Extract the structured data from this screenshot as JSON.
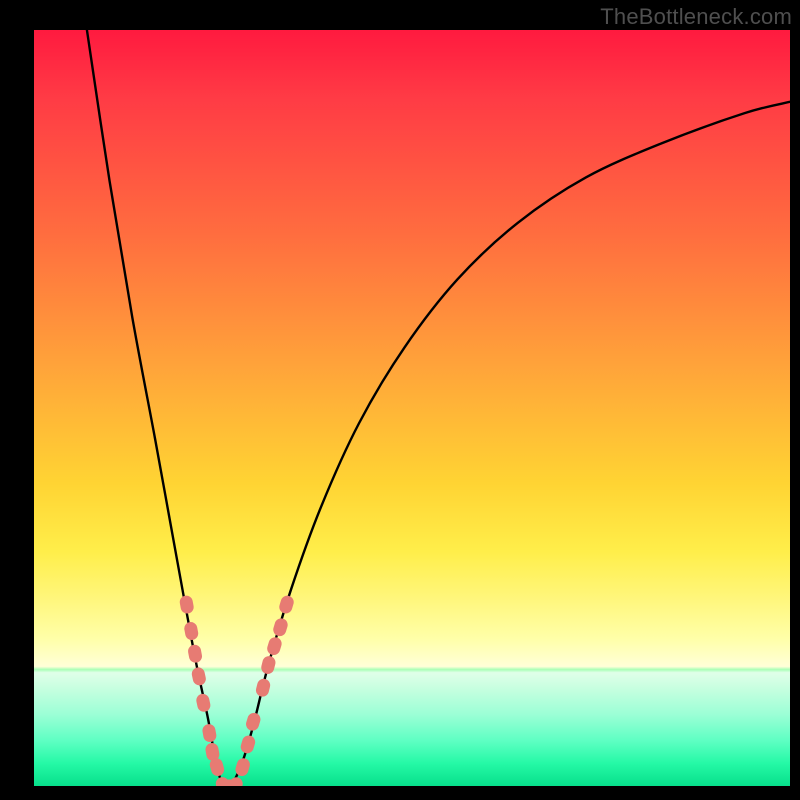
{
  "watermark": "TheBottleneck.com",
  "colors": {
    "background": "#000000",
    "curve_stroke": "#000000",
    "marker_fill": "#e77b73",
    "gradient_top": "#ff1a3f",
    "gradient_bottom": "#07e08b"
  },
  "chart_data": {
    "type": "line",
    "title": "",
    "xlabel": "",
    "ylabel": "",
    "xlim": [
      0,
      100
    ],
    "ylim": [
      0,
      100
    ],
    "grid": false,
    "note": "V-shaped bottleneck curve; y is bottleneck severity (0 = optimal pairing, 100 = extreme bottleneck). Gradient background encodes severity (green good → red bad). Values estimated from pixels.",
    "series": [
      {
        "name": "bottleneck-curve",
        "x": [
          7,
          10,
          13,
          16,
          18,
          20,
          21.5,
          23,
          24,
          25,
          26,
          27.5,
          29,
          31,
          34,
          38,
          43,
          49,
          56,
          64,
          73,
          83,
          94,
          100
        ],
        "y": [
          100,
          80,
          62,
          46,
          35,
          24,
          16,
          9,
          3.5,
          0,
          0,
          3,
          8,
          16,
          26,
          37,
          48,
          58,
          67,
          74.5,
          80.5,
          85,
          89,
          90.5
        ]
      }
    ],
    "markers": {
      "name": "highlighted-points",
      "note": "Salmon capsule/segment markers clustered near the V minimum on both branches and along the flat bottom.",
      "points": [
        {
          "x": 20.2,
          "y": 24.0
        },
        {
          "x": 20.8,
          "y": 20.5
        },
        {
          "x": 21.3,
          "y": 17.5
        },
        {
          "x": 21.8,
          "y": 14.5
        },
        {
          "x": 22.4,
          "y": 11.0
        },
        {
          "x": 23.2,
          "y": 7.0
        },
        {
          "x": 23.6,
          "y": 4.5
        },
        {
          "x": 24.2,
          "y": 2.5
        },
        {
          "x": 25.0,
          "y": 0.0
        },
        {
          "x": 25.8,
          "y": 0.0
        },
        {
          "x": 26.6,
          "y": 0.0
        },
        {
          "x": 27.6,
          "y": 2.5
        },
        {
          "x": 28.3,
          "y": 5.5
        },
        {
          "x": 29.0,
          "y": 8.5
        },
        {
          "x": 30.3,
          "y": 13.0
        },
        {
          "x": 31.0,
          "y": 16.0
        },
        {
          "x": 31.8,
          "y": 18.5
        },
        {
          "x": 32.6,
          "y": 21.0
        },
        {
          "x": 33.4,
          "y": 24.0
        }
      ]
    }
  }
}
